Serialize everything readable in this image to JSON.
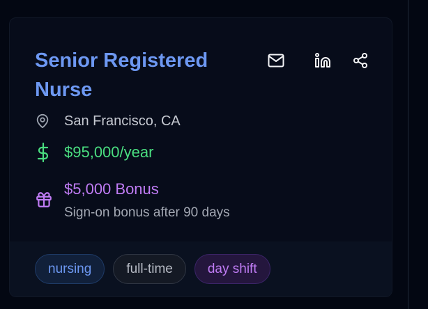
{
  "job": {
    "title": "Senior Registered Nurse",
    "location": "San Francisco, CA",
    "salary": "$95,000/year",
    "bonus": {
      "title": "$5,000 Bonus",
      "description": "Sign-on bonus after 90 days"
    }
  },
  "actions": [
    {
      "name": "email",
      "icon": "mail-icon"
    },
    {
      "name": "linkedin",
      "icon": "linkedin-icon"
    },
    {
      "name": "share",
      "icon": "share-icon"
    }
  ],
  "tags": [
    {
      "label": "nursing",
      "color": "#6d98f2"
    },
    {
      "label": "full-time",
      "color": "#b6bac4"
    },
    {
      "label": "day shift",
      "color": "#c07cf5"
    }
  ],
  "colors": {
    "title": "#6d98f2",
    "salary": "#4ade80",
    "bonus": "#c07cf5",
    "background": "#030712"
  },
  "icons": {
    "location": "map-pin-icon",
    "salary": "dollar-icon",
    "bonus": "gift-icon"
  }
}
